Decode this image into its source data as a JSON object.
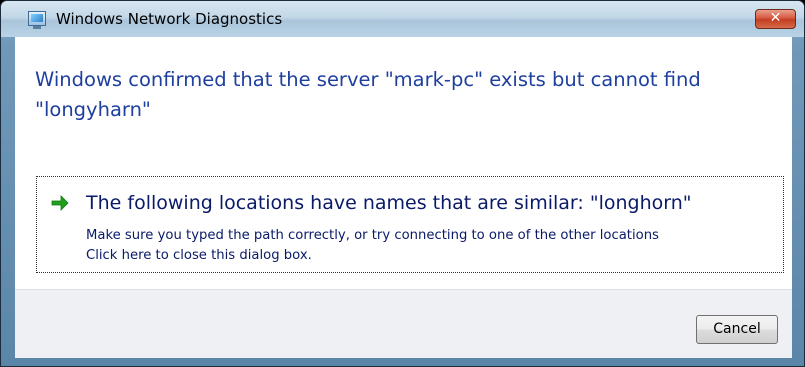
{
  "window": {
    "title": "Windows Network Diagnostics",
    "close_label": "✕",
    "icon": "network-diagnostics-icon"
  },
  "message": {
    "headline": "Windows confirmed that the server \"mark-pc\" exists but cannot find \"longyharn\""
  },
  "option": {
    "icon": "green-arrow-icon",
    "title": "The following locations have names that are similar: \"longhorn\"",
    "line1": "Make sure you typed the path correctly, or try connecting to one of the other locations",
    "line2": "Click here to close this dialog box."
  },
  "footer": {
    "cancel_label": "Cancel"
  },
  "colors": {
    "headline": "#1e3f9e",
    "arrow": "#1ea01e",
    "close_button": "#c9432a"
  }
}
